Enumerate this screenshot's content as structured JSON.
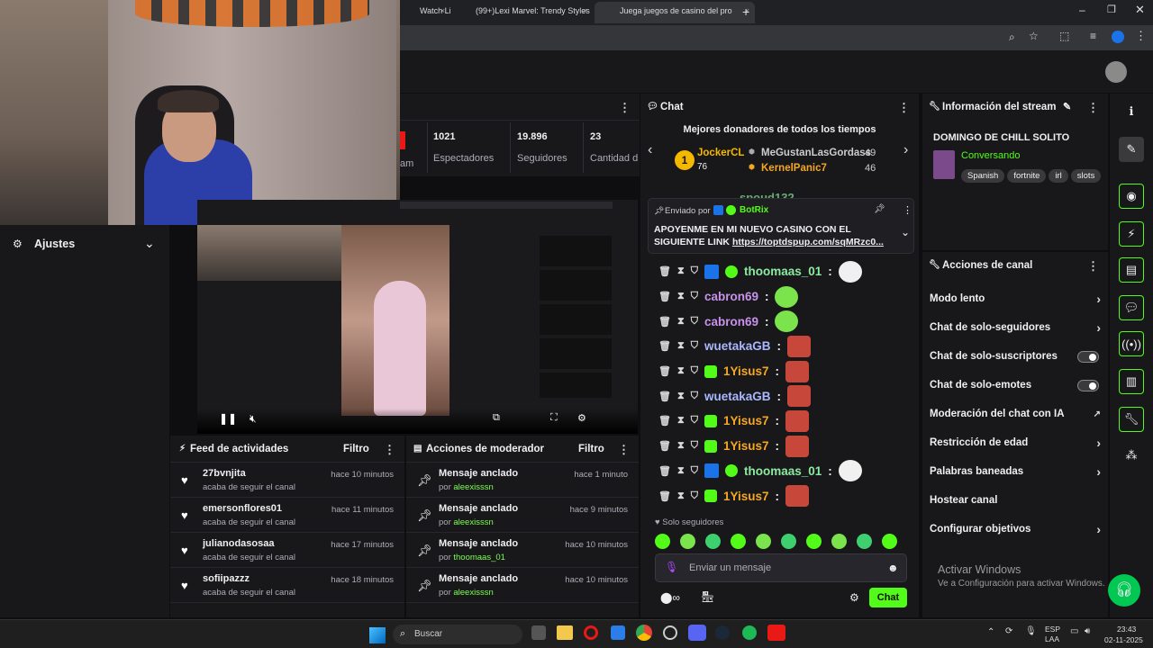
{
  "browser": {
    "tabs": [
      {
        "label": "Watch Li"
      },
      {
        "label": "(99+)Lexi Marvel: Trendy Styles"
      },
      {
        "label": "Juega juegos de casino del pro"
      }
    ],
    "close": "×",
    "new_tab": "+"
  },
  "sidebar": {
    "settings_label": "Ajustes"
  },
  "stats": [
    {
      "value": "1021",
      "label": "Espectadores"
    },
    {
      "value": "19.896",
      "label": "Seguidores"
    },
    {
      "value": "23",
      "label": "Cantidad d"
    }
  ],
  "stats_partial_label": "am",
  "activity_feed": {
    "title": "Feed de actividades",
    "filter": "Filtro",
    "items": [
      {
        "user": "27bvnjita",
        "sub": "acaba de seguir el canal",
        "time": "hace 10 minutos"
      },
      {
        "user": "emersonflores01",
        "sub": "acaba de seguir el canal",
        "time": "hace 11 minutos"
      },
      {
        "user": "julianodasosaa",
        "sub": "acaba de seguir el canal",
        "time": "hace 17 minutos"
      },
      {
        "user": "sofiipazzz",
        "sub": "acaba de seguir el canal",
        "time": "hace 18 minutos"
      }
    ]
  },
  "mod_actions": {
    "title": "Acciones de moderador",
    "filter": "Filtro",
    "items": [
      {
        "action": "Mensaje anclado",
        "by": "por",
        "user": "aleexisssn",
        "time": "hace 1 minuto"
      },
      {
        "action": "Mensaje anclado",
        "by": "por",
        "user": "aleexisssn",
        "time": "hace 9 minutos"
      },
      {
        "action": "Mensaje anclado",
        "by": "por",
        "user": "thoomaas_01",
        "time": "hace 10 minutos"
      },
      {
        "action": "Mensaje anclado",
        "by": "por",
        "user": "aleexisssn",
        "time": "hace 10 minutos"
      }
    ]
  },
  "chat": {
    "title": "Chat",
    "donors_title": "Mejores donadores de todos los tiempos",
    "donors": [
      {
        "rank": "1",
        "name": "JockerCL",
        "amount": "76"
      },
      {
        "name": "MeGustanLasGordass",
        "amount": "49"
      },
      {
        "name": "KernelPanic7",
        "amount": "46"
      }
    ],
    "partial_user": "spoud132",
    "pinned": {
      "label": "Enviado por",
      "sender": "BotRix",
      "text": "APOYENME EN MI NUEVO CASINO CON EL SIGUIENTE LINK",
      "link": "https://toptdspup.com/sqMRzc0..."
    },
    "messages": [
      {
        "user": "thoomaas_01",
        "color": "#8be9a0",
        "emote": "bubble"
      },
      {
        "user": "cabron69",
        "color": "#c792ea",
        "emote": "bean"
      },
      {
        "user": "cabron69",
        "color": "#c792ea",
        "emote": "bean"
      },
      {
        "user": "wuetakaGB",
        "color": "#a9b8ff",
        "emote": "face"
      },
      {
        "user": "1Yisus7",
        "color": "#f5a623",
        "emote": "face"
      },
      {
        "user": "wuetakaGB",
        "color": "#a9b8ff",
        "emote": "face"
      },
      {
        "user": "1Yisus7",
        "color": "#f5a623",
        "emote": "face"
      },
      {
        "user": "1Yisus7",
        "color": "#f5a623",
        "emote": "face"
      },
      {
        "user": "thoomaas_01",
        "color": "#8be9a0",
        "emote": "bubble"
      },
      {
        "user": "1Yisus7",
        "color": "#f5a623",
        "emote": "face"
      }
    ],
    "followers_only": "Solo seguidores",
    "input_placeholder": "Enviar un mensaje",
    "send": "Chat"
  },
  "stream_info": {
    "title": "Información del stream",
    "stream_title": "DOMINGO DE CHILL SOLITO",
    "category": "Conversando",
    "tags": [
      "Spanish",
      "fortnite",
      "irl",
      "slots"
    ]
  },
  "channel_actions": {
    "title": "Acciones de canal",
    "options": [
      {
        "label": "Modo lento",
        "control": "chevron"
      },
      {
        "label": "Chat de solo-seguidores",
        "control": "chevron"
      },
      {
        "label": "Chat de solo-suscriptores",
        "control": "toggle"
      },
      {
        "label": "Chat de solo-emotes",
        "control": "toggle"
      },
      {
        "label": "Moderación del chat con IA",
        "control": "external"
      },
      {
        "label": "Restricción de edad",
        "control": "chevron"
      },
      {
        "label": "Palabras baneadas",
        "control": "chevron"
      },
      {
        "label": "Hostear canal",
        "control": "none"
      },
      {
        "label": "Configurar objetivos",
        "control": "chevron"
      }
    ]
  },
  "watermark": {
    "title": "Activar Windows",
    "sub": "Ve a Configuración para activar Windows."
  },
  "taskbar": {
    "search": "Buscar",
    "lang": "ESP",
    "lang2": "LAA",
    "time": "23:43",
    "date": "02-11-2025"
  },
  "colors": {
    "accent": "#53fc18",
    "bg": "#0e0e10",
    "panel": "#18181b"
  }
}
